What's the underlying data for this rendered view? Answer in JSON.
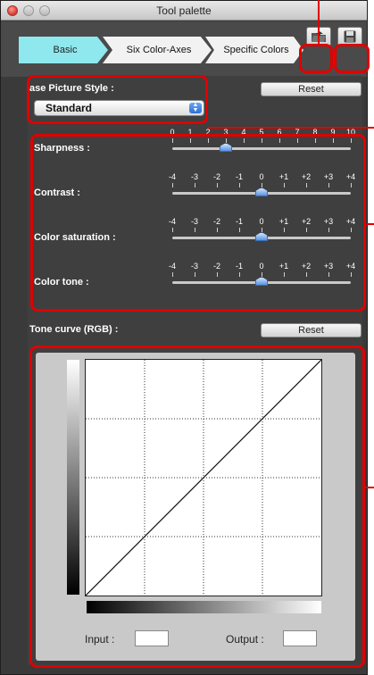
{
  "window": {
    "title": "Tool palette"
  },
  "tabs": [
    {
      "label": "Basic",
      "active": true
    },
    {
      "label": "Six Color-Axes",
      "active": false
    },
    {
      "label": "Specific Colors",
      "active": false
    }
  ],
  "toolbar": {
    "load_icon": "open-folder-icon",
    "save_icon": "floppy-disk-icon"
  },
  "picture_style": {
    "label": "ase Picture Style :",
    "reset_label": "Reset",
    "selected": "Standard"
  },
  "sliders": [
    {
      "label": "Sharpness :",
      "scale": [
        "0",
        "1",
        "2",
        "3",
        "4",
        "5",
        "6",
        "7",
        "8",
        "9",
        "10"
      ],
      "value": 3
    },
    {
      "label": "Contrast :",
      "scale": [
        "-4",
        "-3",
        "-2",
        "-1",
        "0",
        "+1",
        "+2",
        "+3",
        "+4"
      ],
      "value": 0
    },
    {
      "label": "Color saturation :",
      "scale": [
        "-4",
        "-3",
        "-2",
        "-1",
        "0",
        "+1",
        "+2",
        "+3",
        "+4"
      ],
      "value": 0
    },
    {
      "label": "Color tone :",
      "scale": [
        "-4",
        "-3",
        "-2",
        "-1",
        "0",
        "+1",
        "+2",
        "+3",
        "+4"
      ],
      "value": 0
    }
  ],
  "tone_curve": {
    "label": "Tone curve (RGB) :",
    "reset_label": "Reset",
    "input_label": "Input :",
    "input_value": "",
    "output_label": "Output :",
    "output_value": ""
  },
  "colors": {
    "highlight_red": "#e00000",
    "active_tab": "#8fe8ee",
    "panel_bg": "#3f3f3f"
  }
}
